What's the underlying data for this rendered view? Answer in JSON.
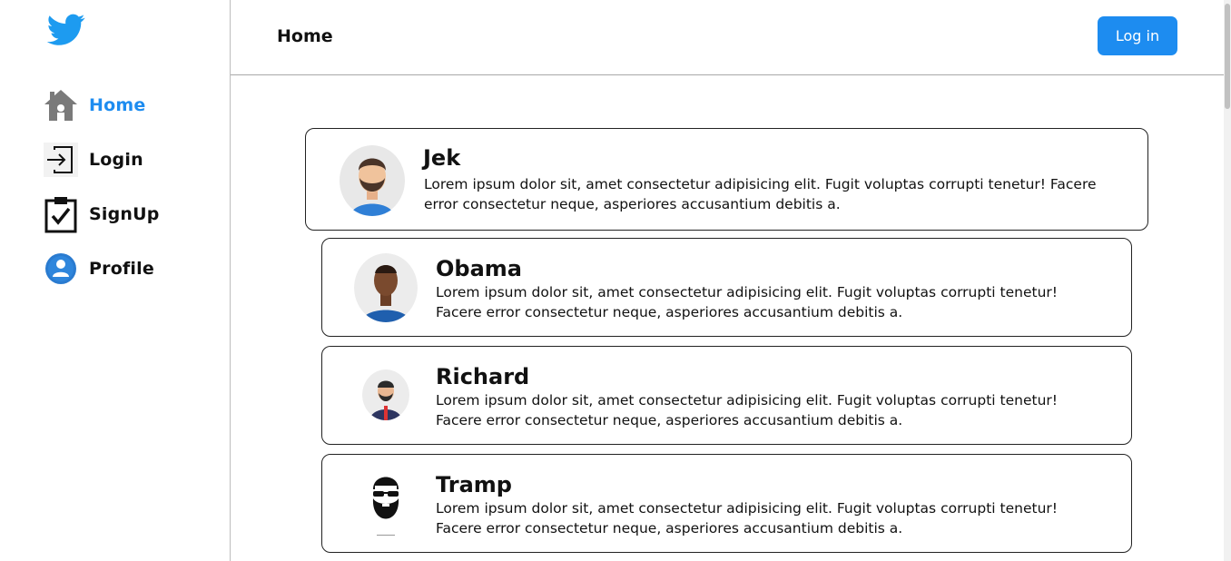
{
  "brand": {
    "logo_icon": "twitter-bird-icon",
    "color": "#1d8cf0"
  },
  "sidebar": {
    "items": [
      {
        "label": "Home",
        "icon": "home-icon",
        "active": true
      },
      {
        "label": "Login",
        "icon": "login-icon",
        "active": false
      },
      {
        "label": "SignUp",
        "icon": "clipboard-check-icon",
        "active": false
      },
      {
        "label": "Profile",
        "icon": "profile-icon",
        "active": false
      }
    ]
  },
  "header": {
    "title": "Home",
    "login_label": "Log in"
  },
  "feed": {
    "posts": [
      {
        "name": "Jek",
        "text": "Lorem ipsum dolor sit, amet consectetur adipisicing elit. Fugit voluptas corrupti tenetur! Facere error consectetur neque, asperiores accusantium debitis a."
      },
      {
        "name": "Obama",
        "text": "Lorem ipsum dolor sit, amet consectetur adipisicing elit. Fugit voluptas corrupti tenetur! Facere error consectetur neque, asperiores accusantium debitis a."
      },
      {
        "name": "Richard",
        "text": "Lorem ipsum dolor sit, amet consectetur adipisicing elit. Fugit voluptas corrupti tenetur! Facere error consectetur neque, asperiores accusantium debitis a."
      },
      {
        "name": "Tramp",
        "text": "Lorem ipsum dolor sit, amet consectetur adipisicing elit. Fugit voluptas corrupti tenetur! Facere error consectetur neque, asperiores accusantium debitis a."
      }
    ]
  }
}
